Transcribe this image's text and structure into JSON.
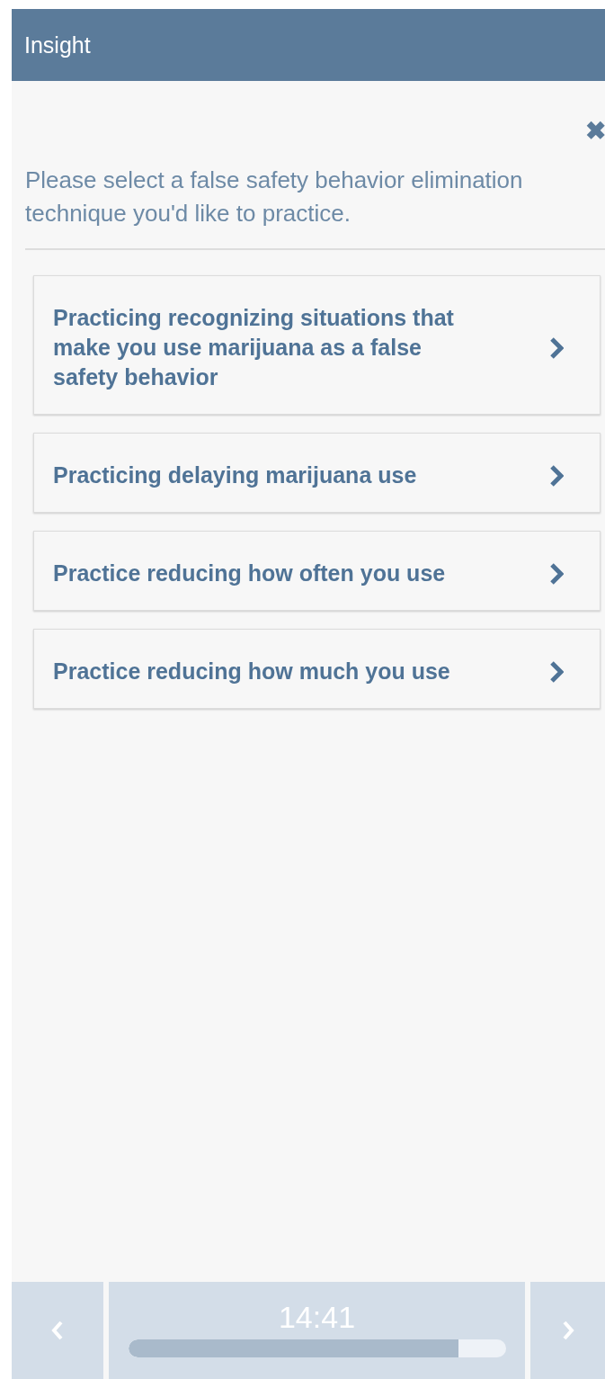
{
  "header": {
    "title": "Insight"
  },
  "close": {
    "label": "✖"
  },
  "prompt": "Please select a false safety behavior elimination technique you'd like to practice.",
  "options": [
    {
      "label": "Practicing recognizing situations that make you use marijuana as a false safety behavior"
    },
    {
      "label": "Practicing delaying marijuana use"
    },
    {
      "label": "Practice reducing how often you use"
    },
    {
      "label": "Practice reducing how much you use"
    }
  ],
  "footer": {
    "time": "14:41",
    "level": 0.874
  }
}
